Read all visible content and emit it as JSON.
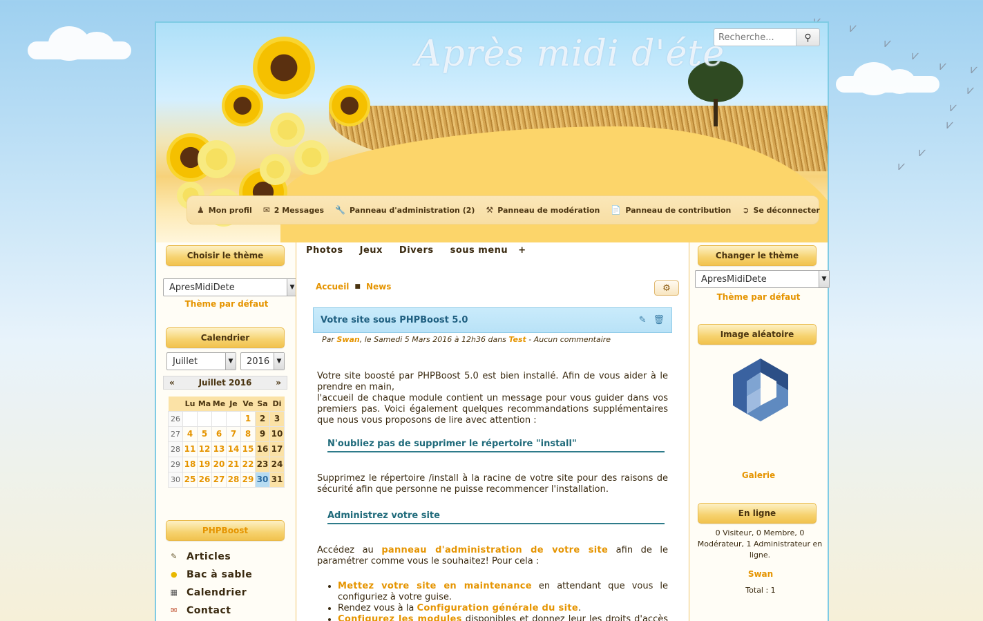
{
  "site_title": "Après midi d'été",
  "search": {
    "placeholder": "Recherche..."
  },
  "userbar": [
    {
      "icon": "user-icon",
      "label": "Mon profil"
    },
    {
      "icon": "envelope-icon",
      "label": "2 Messages"
    },
    {
      "icon": "wrench-icon",
      "label": "Panneau d'administration (2)"
    },
    {
      "icon": "gavel-icon",
      "label": "Panneau de modération"
    },
    {
      "icon": "document-icon",
      "label": "Panneau de contribution"
    },
    {
      "icon": "logout-icon",
      "label": "Se déconnecter"
    }
  ],
  "left": {
    "theme_title": "Choisir le thème",
    "theme_value": "ApresMidiDete",
    "theme_default": "Thème par défaut",
    "calendar_title": "Calendrier",
    "cal_month_value": "Juillet",
    "cal_year_value": "2016",
    "cal_nav_label": "Juillet 2016",
    "cal_prev": "«",
    "cal_next": "»",
    "cal_days": [
      "Lu",
      "Ma",
      "Me",
      "Je",
      "Ve",
      "Sa",
      "Di"
    ],
    "cal_weeks": [
      {
        "wk": "26",
        "days": [
          "",
          "",
          "",
          "",
          "1",
          "2",
          "3"
        ]
      },
      {
        "wk": "27",
        "days": [
          "4",
          "5",
          "6",
          "7",
          "8",
          "9",
          "10"
        ]
      },
      {
        "wk": "28",
        "days": [
          "11",
          "12",
          "13",
          "14",
          "15",
          "16",
          "17"
        ]
      },
      {
        "wk": "29",
        "days": [
          "18",
          "19",
          "20",
          "21",
          "22",
          "23",
          "24"
        ]
      },
      {
        "wk": "30",
        "days": [
          "25",
          "26",
          "27",
          "28",
          "29",
          "30",
          "31"
        ]
      }
    ],
    "cal_today": "30",
    "menu_title": "PHPBoost",
    "menu_items": [
      {
        "icon": "pencil-icon",
        "label": "Articles"
      },
      {
        "icon": "helmet-icon",
        "label": "Bac à sable"
      },
      {
        "icon": "calendar-icon",
        "label": "Calendrier"
      },
      {
        "icon": "contact-icon",
        "label": "Contact"
      }
    ]
  },
  "center": {
    "nav": [
      "Photos",
      "Jeux",
      "Divers",
      "sous menu"
    ],
    "nav_plus": "+",
    "breadcrumb": [
      "Accueil",
      "News"
    ],
    "news_title": "Votre site sous PHPBoost 5.0",
    "meta_par": "Par ",
    "meta_author": "Swan",
    "meta_date": ", le Samedi 5 Mars 2016 à 12h36 dans ",
    "meta_cat": "Test",
    "meta_comments": " - Aucun commentaire",
    "p1a": "Votre site boosté par PHPBoost 5.0 est bien installé. Afin de vous aider à le prendre en main,",
    "p1b": "l'accueil de chaque module contient un message pour vous guider dans vos premiers pas. Voici également quelques recommandations supplémentaires que nous vous proposons de lire avec attention :",
    "h_install": "N'oubliez pas de supprimer le répertoire \"install\"",
    "p2": "Supprimez le répertoire /install à la racine de votre site pour des raisons de sécurité afin que personne ne puisse recommencer l'installation.",
    "h_admin": "Administrez votre site",
    "p3_before": "Accédez au ",
    "p3_link": "panneau d'administration de votre site",
    "p3_after": " afin de le paramétrer comme vous le souhaitez! Pour cela :",
    "li1_link": "Mettez votre site en maintenance",
    "li1_text": " en attendant que vous le configuriez à votre guise.",
    "li2_text": "Rendez vous à la ",
    "li2_link": "Configuration générale du site",
    "li2_end": ".",
    "li3_link": "Configurez les modules",
    "li3_text": " disponibles et donnez leur les droits d'accès (si vous n'avez pas installé le pack complet, tous les modules sont disponibles"
  },
  "right": {
    "theme_title": "Changer le thème",
    "theme_value": "ApresMidiDete",
    "theme_default": "Thème par défaut",
    "image_title": "Image aléatoire",
    "gallery_link": "Galerie",
    "online_title": "En ligne",
    "online_text": "0 Visiteur, 0 Membre, 0 Modérateur, 1 Administrateur en ligne.",
    "online_user": "Swan",
    "total": "Total : 1"
  },
  "colors": {
    "accent": "#e59400",
    "heading": "#1f6a7a",
    "news_bg": "#c9ebfb"
  }
}
